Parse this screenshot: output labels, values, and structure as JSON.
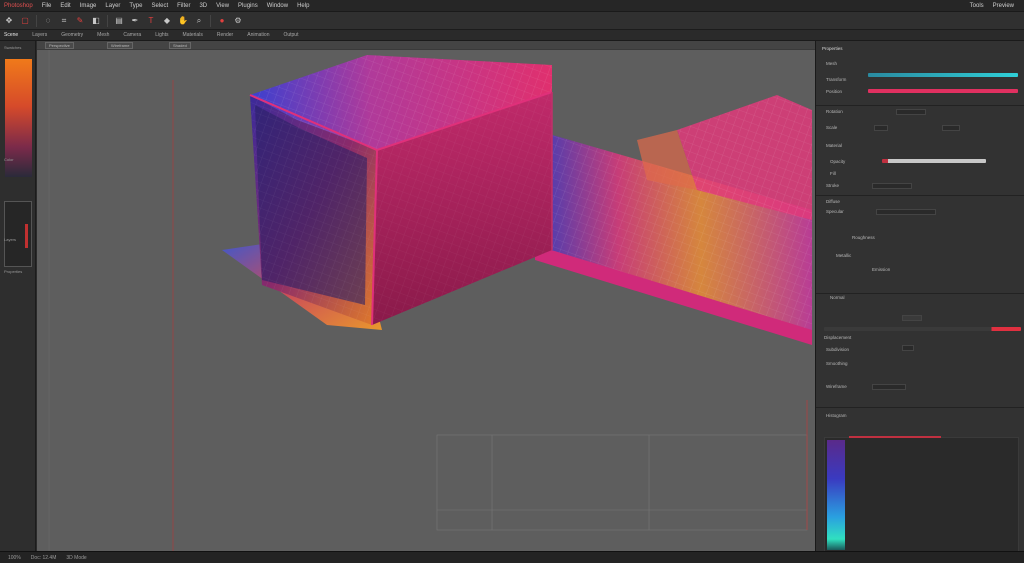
{
  "menubar": {
    "items": [
      "Photoshop",
      "File",
      "Edit",
      "Image",
      "Layer",
      "Type",
      "Select",
      "Filter",
      "3D",
      "View",
      "Plugins",
      "Window",
      "Help"
    ],
    "right": [
      "Tools",
      "Preview"
    ]
  },
  "toolbar": {
    "icons": [
      "move-icon",
      "marquee-icon",
      "lasso-icon",
      "crop-icon",
      "brush-icon",
      "eraser-icon",
      "gradient-icon",
      "pen-icon",
      "text-icon",
      "shape-icon",
      "hand-icon",
      "zoom-icon"
    ]
  },
  "tabs": [
    "Scene",
    "Layers",
    "Geometry",
    "Mesh",
    "Camera",
    "Lights",
    "Materials",
    "Render",
    "Animation",
    "Output"
  ],
  "viewport": {
    "tabs": [
      "Perspective",
      "Wireframe",
      "Shaded"
    ]
  },
  "left_panel": {
    "labels": [
      "Swatches",
      "Color",
      "Layers",
      "Properties"
    ]
  },
  "right_panel": {
    "header": "Properties",
    "rows": [
      "Mesh",
      "Transform",
      "Position",
      "Rotation",
      "Scale",
      "Material",
      "Opacity",
      "Fill",
      "Stroke",
      "Diffuse",
      "Specular",
      "Roughness",
      "Metallic",
      "Emission",
      "Normal",
      "Displacement",
      "Subdivision",
      "Smoothing",
      "Wireframe"
    ],
    "histogram": "Histogram"
  },
  "status": {
    "items": [
      "100%",
      "Doc: 12.4M",
      "3D Mode"
    ]
  },
  "colors": {
    "accent_red": "#e2403e",
    "cyan_slider": "#2fd0d8",
    "magenta_slider": "#e03060"
  }
}
